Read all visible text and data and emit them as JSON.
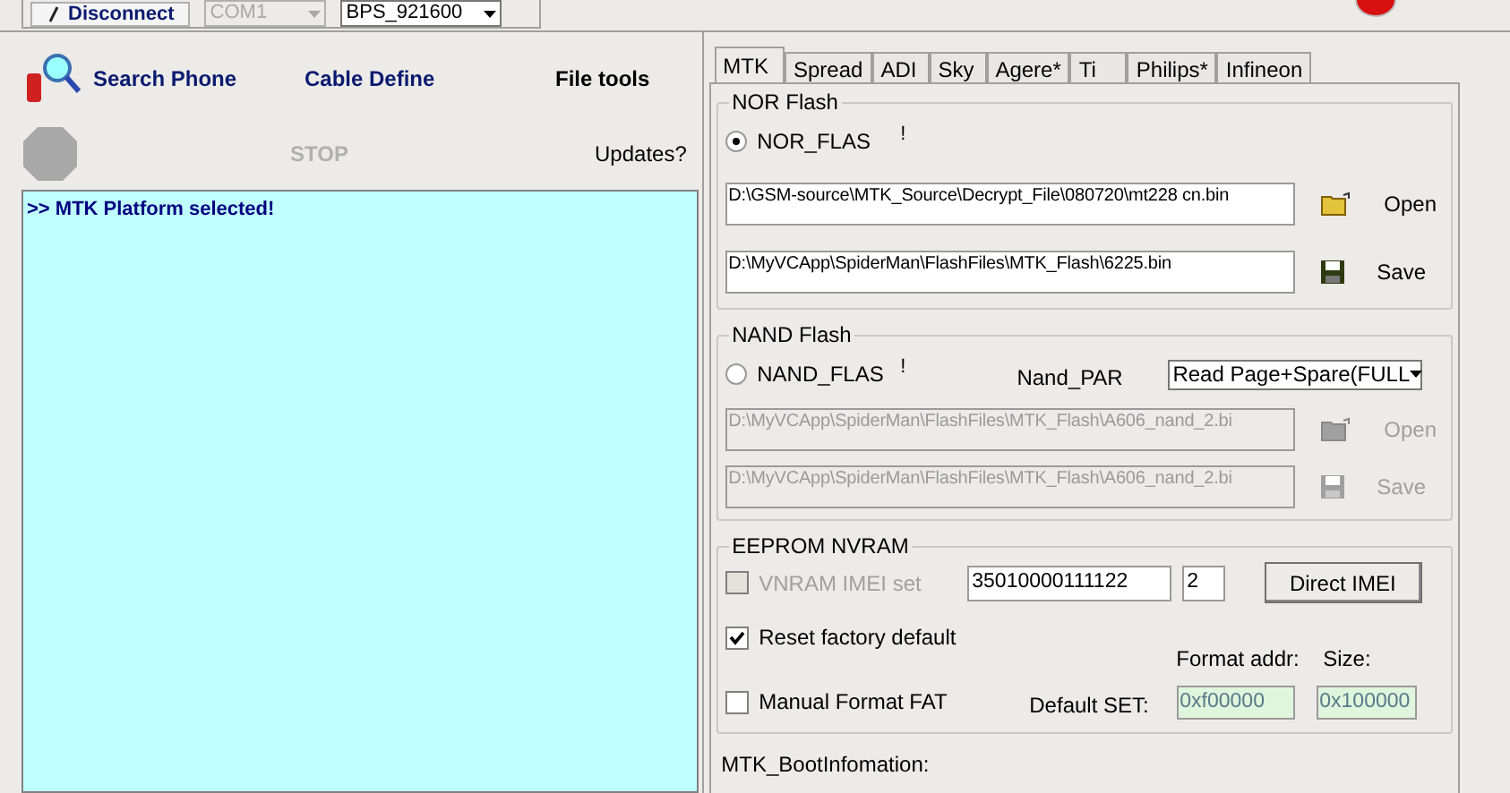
{
  "toolbar": {
    "connect_button": "Disconnect",
    "port_select": {
      "value": "COM1",
      "disabled": true
    },
    "baud_select": {
      "value": "BPS_921600",
      "disabled": false
    }
  },
  "actions": {
    "search_phone": "Search Phone",
    "cable_define": "Cable Define",
    "file_tools": "File tools",
    "stop": {
      "label": "STOP",
      "disabled": true
    },
    "updates": "Updates?"
  },
  "log": {
    "lines": [
      ">> MTK Platform selected!"
    ]
  },
  "tabs": [
    {
      "label": "MTK",
      "selected": true
    },
    {
      "label": "Spread",
      "selected": false
    },
    {
      "label": "ADI",
      "selected": false
    },
    {
      "label": "Sky",
      "selected": false
    },
    {
      "label": "Agere*",
      "selected": false
    },
    {
      "label": "Ti",
      "selected": false
    },
    {
      "label": "Philips*",
      "selected": false
    },
    {
      "label": "Infineon",
      "selected": false
    }
  ],
  "nor_flash": {
    "title": "NOR Flash",
    "radio": {
      "label": "NOR_FLAS",
      "selected": true
    },
    "mark": "!",
    "files": [
      {
        "kind": "open",
        "path": "D:\\GSM-source\\MTK_Source\\Decrypt_File\\080720\\mt228 cn.bin",
        "button": "Open",
        "disabled": false
      },
      {
        "kind": "save",
        "path": "D:\\MyVCApp\\SpiderMan\\FlashFiles\\MTK_Flash\\6225.bin",
        "button": "Save",
        "disabled": false
      }
    ]
  },
  "nand_flash": {
    "title": "NAND Flash",
    "radio": {
      "label": "NAND_FLAS",
      "selected": false
    },
    "mark": "!",
    "part_label": "Nand_PAR",
    "part_select": "Read Page+Spare(FULL",
    "files": [
      {
        "kind": "open",
        "path": "D:\\MyVCApp\\SpiderMan\\FlashFiles\\MTK_Flash\\A606_nand_2.bi",
        "button": "Open",
        "disabled": true
      },
      {
        "kind": "save",
        "path": "D:\\MyVCApp\\SpiderMan\\FlashFiles\\MTK_Flash\\A606_nand_2.bi",
        "button": "Save",
        "disabled": true
      }
    ]
  },
  "eeprom": {
    "title": "EEPROM NVRAM",
    "imei_checkbox": {
      "label": "VNRAM IMEI set",
      "checked": false,
      "disabled": true
    },
    "imei": "35010000111122",
    "imei_count": "2",
    "direct_imei_button": "Direct IMEI",
    "reset_checkbox": {
      "label": "Reset factory default",
      "checked": true,
      "disabled": false
    },
    "format_checkbox": {
      "label": "Manual Format FAT",
      "checked": false,
      "disabled": false
    },
    "format_addr_label": "Format addr:",
    "size_label": "Size:",
    "default_set_label": "Default SET:",
    "format_addr": "0xf00000",
    "size": "0x100000"
  },
  "boot_info_label": "MTK_BootInfomation:"
}
